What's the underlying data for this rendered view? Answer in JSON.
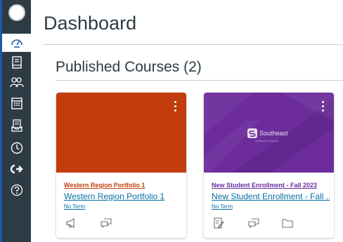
{
  "dashboard": {
    "title": "Dashboard"
  },
  "section": {
    "title": "Published Courses (2)"
  },
  "colors": {
    "nav_bg": "#2d3b45",
    "nav_border": "#1c5ba8",
    "link": "#0770a3"
  },
  "nav": {
    "items": [
      {
        "icon": "account-avatar-icon"
      },
      {
        "icon": "dashboard-icon"
      },
      {
        "icon": "courses-icon"
      },
      {
        "icon": "groups-icon"
      },
      {
        "icon": "calendar-icon"
      },
      {
        "icon": "inbox-icon"
      },
      {
        "icon": "history-icon"
      },
      {
        "icon": "commons-icon"
      },
      {
        "icon": "help-icon"
      }
    ]
  },
  "courses": [
    {
      "short_name": "Western Region Portfolio 1",
      "name": "Western Region Portfolio 1",
      "term": "No Term",
      "hero_color": "#c23c0d",
      "short_color": "#c23c0d",
      "actions": [
        "announcements-icon",
        "discussions-icon"
      ]
    },
    {
      "short_name": "New Student Enrollment - Fall 2023",
      "name": "New Student Enrollment - Fall ...",
      "term": "No Term",
      "hero_color": "#6c2c9c",
      "short_color": "#6c2c9c",
      "logo_text": "Southeast",
      "logo_sub": "COMMUNITY COLLEGE",
      "actions": [
        "assignments-icon",
        "discussions-icon",
        "files-icon"
      ]
    }
  ]
}
